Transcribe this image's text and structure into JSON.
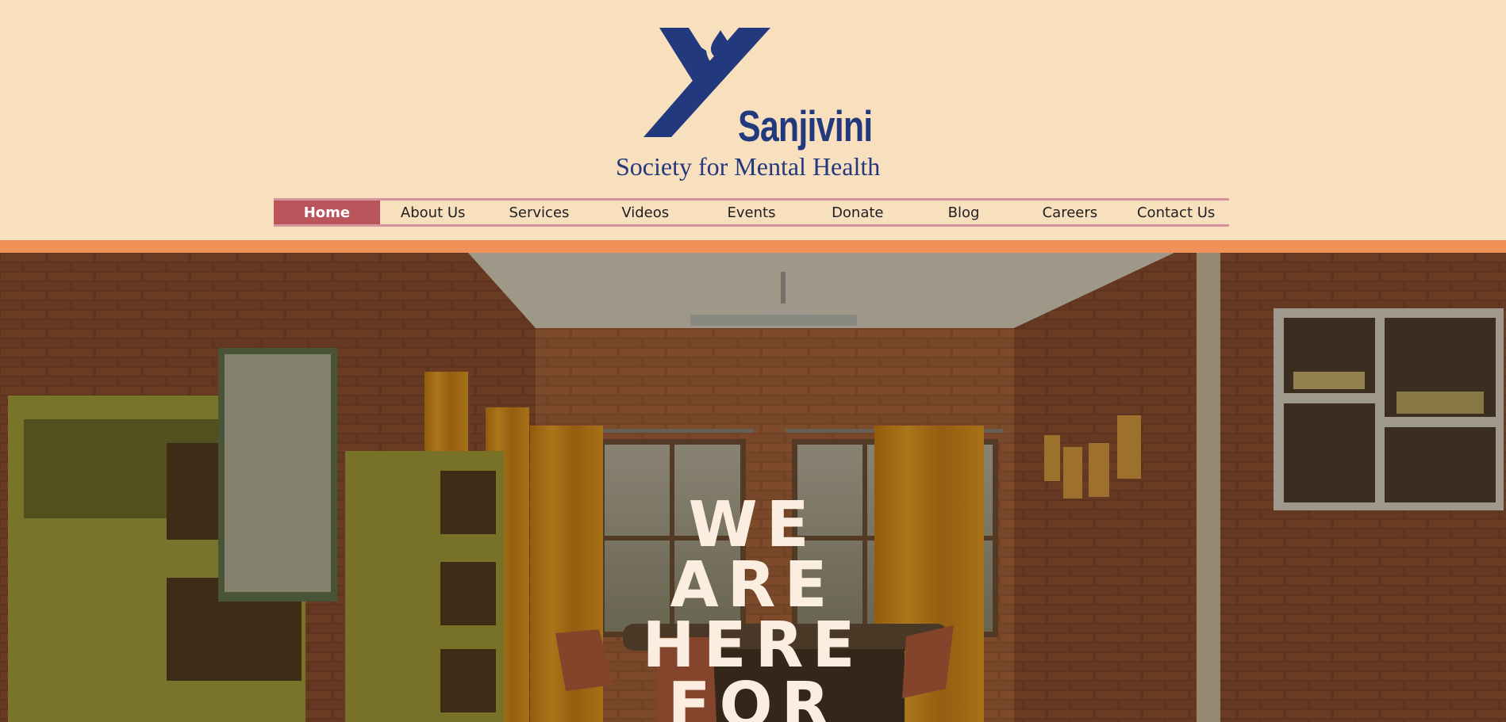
{
  "brand": {
    "name": "Sanjivini",
    "tagline": "Society for Mental Health",
    "logo_icon": "stylized-y-with-flame-icon",
    "primary_color": "#23397e"
  },
  "nav": {
    "items": [
      {
        "label": "Home",
        "active": true
      },
      {
        "label": "About Us"
      },
      {
        "label": "Services"
      },
      {
        "label": "Videos"
      },
      {
        "label": "Events"
      },
      {
        "label": "Donate"
      },
      {
        "label": "Blog"
      },
      {
        "label": "Careers"
      },
      {
        "label": "Contact Us"
      }
    ],
    "active_color": "#b9555b",
    "border_color": "#d6929d"
  },
  "colors": {
    "header_bg": "#f8dfbe",
    "accent_bar": "#ef9159"
  },
  "hero": {
    "heading_lines": [
      "WE",
      "ARE",
      "HERE",
      "FOR"
    ],
    "image": "room-with-brick-walls-and-yellow-curtains"
  }
}
